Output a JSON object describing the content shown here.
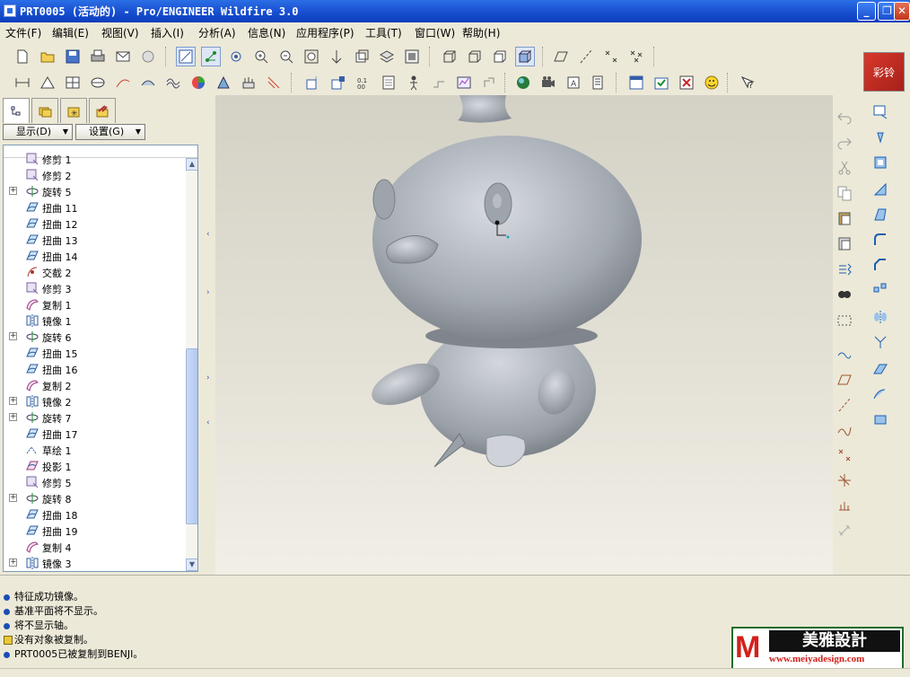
{
  "window": {
    "title": "PRT0005 (活动的) - Pro/ENGINEER Wildfire 3.0",
    "controls": [
      "minimize",
      "maximize",
      "close"
    ]
  },
  "menubar": {
    "items": [
      "文件(F)",
      "编辑(E)",
      "视图(V)",
      "插入(I)",
      "分析(A)",
      "信息(N)",
      "应用程序(P)",
      "工具(T)",
      "窗口(W)",
      "帮助(H)"
    ]
  },
  "toolbar1": {
    "icons": [
      "new-file-icon",
      "open-file-icon",
      "save-icon",
      "print-icon",
      "send-mail-icon",
      "mail-attach-icon",
      "redraw-icon",
      "spin-center-icon",
      "orient-mode-icon",
      "zoom-in-icon",
      "zoom-out-icon",
      "refit-icon",
      "reorient-icon",
      "saved-views-icon",
      "layers-icon",
      "view-manager-icon",
      "wireframe-icon",
      "hidden-line-icon",
      "no-hidden-icon",
      "shading-icon",
      "datum-planes-icon",
      "datum-axes-icon",
      "datum-points-icon",
      "coord-sys-icon"
    ]
  },
  "toolbar2": {
    "icons": [
      "measure-icon",
      "area-icon",
      "mass-props-icon",
      "section-analysis-icon",
      "curvature-icon",
      "surface-analysis-icon",
      "curve-analysis-icon",
      "color-shading-icon",
      "draft-check-icon",
      "offset-analysis-icon",
      "datum-analysis-icon",
      "feature-info-icon",
      "model-info-icon",
      "bom-icon",
      "reference-icon",
      "manikin-icon",
      "relations-icon",
      "parameters-icon",
      "switch-dims-icon",
      "appearance-icon",
      "animation-icon",
      "mapkey-icon",
      "trail-icon",
      "window-list-icon",
      "activate-icon",
      "close-window-icon",
      "smiley-icon",
      "context-help-icon"
    ]
  },
  "brand_logo": {
    "text": "彩铃"
  },
  "panel": {
    "tabs": [
      "model-tree-tab-icon",
      "folder-browser-tab-icon",
      "favorites-tab-icon",
      "connections-tab-icon"
    ],
    "show_button": "显示(D)",
    "settings_button": "设置(G)"
  },
  "tree": {
    "items": [
      {
        "label": "修剪 1",
        "icon": "trim-icon",
        "expandable": false,
        "partial": true
      },
      {
        "label": "修剪 2",
        "icon": "trim-icon",
        "expandable": false
      },
      {
        "label": "旋转 5",
        "icon": "revolve-icon",
        "expandable": true
      },
      {
        "label": "扭曲 11",
        "icon": "warp-icon",
        "expandable": false
      },
      {
        "label": "扭曲 12",
        "icon": "warp-icon",
        "expandable": false
      },
      {
        "label": "扭曲 13",
        "icon": "warp-icon",
        "expandable": false
      },
      {
        "label": "扭曲 14",
        "icon": "warp-icon",
        "expandable": false
      },
      {
        "label": "交截 2",
        "icon": "intersect-icon",
        "expandable": false
      },
      {
        "label": "修剪 3",
        "icon": "trim-icon",
        "expandable": false
      },
      {
        "label": "复制 1",
        "icon": "copy-icon",
        "expandable": false
      },
      {
        "label": "镜像 1",
        "icon": "mirror-icon",
        "expandable": false
      },
      {
        "label": "旋转 6",
        "icon": "revolve-icon",
        "expandable": true
      },
      {
        "label": "扭曲 15",
        "icon": "warp-icon",
        "expandable": false
      },
      {
        "label": "扭曲 16",
        "icon": "warp-icon",
        "expandable": false
      },
      {
        "label": "复制 2",
        "icon": "copy-icon",
        "expandable": false
      },
      {
        "label": "镜像 2",
        "icon": "mirror-icon",
        "expandable": true
      },
      {
        "label": "旋转 7",
        "icon": "revolve-icon",
        "expandable": true
      },
      {
        "label": "扭曲 17",
        "icon": "warp-icon",
        "expandable": false
      },
      {
        "label": "草绘 1",
        "icon": "sketch-icon",
        "expandable": false
      },
      {
        "label": "投影 1",
        "icon": "project-icon",
        "expandable": false
      },
      {
        "label": "修剪 5",
        "icon": "trim-icon",
        "expandable": false
      },
      {
        "label": "旋转 8",
        "icon": "revolve-icon",
        "expandable": true
      },
      {
        "label": "扭曲 18",
        "icon": "warp-icon",
        "expandable": false
      },
      {
        "label": "扭曲 19",
        "icon": "warp-icon",
        "expandable": false
      },
      {
        "label": "复制 4",
        "icon": "copy-icon",
        "expandable": false
      },
      {
        "label": "镜像 3",
        "icon": "mirror-icon",
        "expandable": true
      }
    ]
  },
  "right_toolbar": {
    "icons": [
      "undo-icon",
      "redo-icon",
      "cut-icon",
      "copy-icon",
      "paste-icon",
      "paste-special-icon",
      "regenerate-icon",
      "find-icon",
      "selection-box-icon",
      "sketch-curve-icon",
      "datum-plane-icon",
      "datum-axis-icon",
      "datum-curve-icon",
      "datum-point-icon",
      "csys-icon",
      "analysis-feature-icon",
      "link-icon",
      "text-note-icon",
      "hole-icon",
      "shell-icon",
      "rib-icon",
      "draft-icon",
      "round-icon",
      "chamfer-icon",
      "pattern-icon",
      "mirror-tool-icon",
      "merge-icon",
      "trim-tool-icon",
      "extend-icon",
      "offset-icon"
    ]
  },
  "messages": [
    {
      "type": "info",
      "text": "特征成功镜像。"
    },
    {
      "type": "info",
      "text": "基准平面将不显示。"
    },
    {
      "type": "info",
      "text": "将不显示轴。"
    },
    {
      "type": "warning",
      "text": "没有对象被复制。"
    },
    {
      "type": "info",
      "text": "PRT0005已被复制到BENJI。"
    }
  ],
  "watermark": {
    "logo": "M",
    "name": "美雅設計",
    "url": "www.meiyadesign.com"
  },
  "colors": {
    "titlebar": "#0a3dbd",
    "chrome": "#ece9d8",
    "model": "#a7acb3",
    "viewport": "#e3e1d6"
  }
}
